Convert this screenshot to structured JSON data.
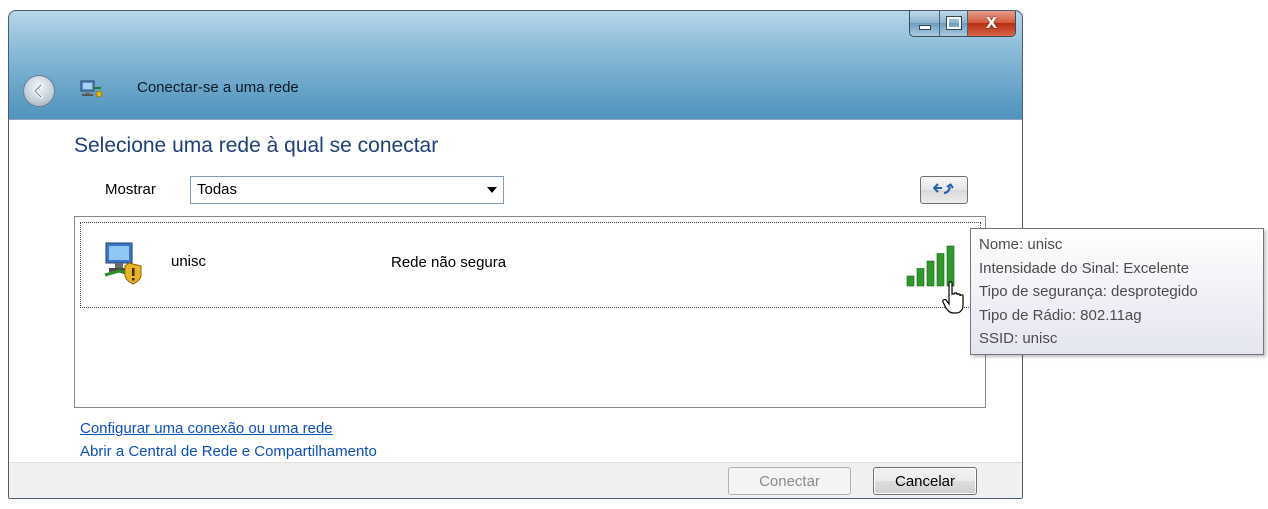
{
  "window": {
    "title": "Conectar-se a uma rede",
    "controls": {
      "minimize_icon": "minimize-icon",
      "maximize_icon": "maximize-icon",
      "close_label": "X"
    }
  },
  "main": {
    "heading": "Selecione uma rede à qual se conectar",
    "filter": {
      "label": "Mostrar",
      "selected": "Todas"
    },
    "refresh_icon": "refresh-arrows-icon"
  },
  "networks": [
    {
      "name": "unisc",
      "security": "Rede não segura",
      "signal_strength": 5,
      "signal_max": 5,
      "icon": "unsecured-network-shield-icon"
    }
  ],
  "links": {
    "setup": "Configurar uma conexão ou uma rede",
    "network_center": "Abrir a Central de Rede e Compartilhamento"
  },
  "buttons": {
    "connect": "Conectar",
    "cancel": "Cancelar"
  },
  "tooltip": {
    "line1": "Nome: unisc",
    "line2": "Intensidade do Sinal: Excelente",
    "line3": "Tipo de segurança: desprotegido",
    "line4": "Tipo de Rádio: 802.11ag",
    "line5": "SSID: unisc"
  },
  "colors": {
    "heading": "#1e3f7a",
    "link": "#0a4fbf",
    "signal": "#2e9a2a",
    "title_bar": "#3f86b7"
  }
}
